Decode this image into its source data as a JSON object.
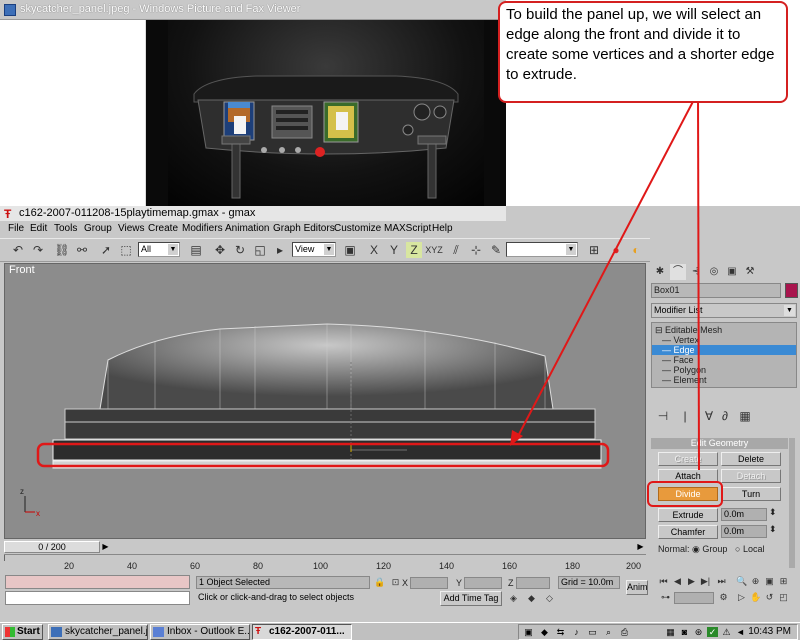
{
  "viewer": {
    "title": "skycatcher_panel.jpeg - Windows Picture and Fax Viewer"
  },
  "callout": {
    "text": "To build the panel up, we will select an edge along the front and divide it to create some vertices and a shorter edge to extrude."
  },
  "gmax": {
    "title": "c162-2007-011208-15playtimemap.gmax - gmax",
    "menu": [
      "File",
      "Edit",
      "Tools",
      "Group",
      "Views",
      "Create",
      "Modifiers",
      "Animation",
      "Graph Editors",
      "Customize",
      "MAXScript",
      "Help"
    ],
    "toolbar": {
      "selection_filter": "All",
      "ref_coord": "View",
      "axis_xyz_label": "XYZ"
    },
    "viewport": {
      "label": "Front"
    },
    "command_panel": {
      "object_name": "Box01",
      "object_color": "#a8144d",
      "modifier_list": "Modifier List",
      "stack": [
        "Editable Mesh",
        "Vertex",
        "Edge",
        "Face",
        "Polygon",
        "Element"
      ],
      "stack_selected": "Edge",
      "rollout_title": "Edit Geometry",
      "buttons": {
        "create": "Create",
        "delete": "Delete",
        "attach": "Attach",
        "detach": "Detach",
        "divide": "Divide",
        "turn": "Turn",
        "extrude": "Extrude",
        "chamfer": "Chamfer"
      },
      "extrude_value": "0.0m",
      "chamfer_value": "0.0m",
      "normal_label": "Normal:",
      "normal_group": "Group",
      "normal_local": "Local"
    },
    "time_slider": "0 / 200",
    "track_labels": [
      "20",
      "40",
      "60",
      "80",
      "100",
      "120",
      "140",
      "160",
      "180",
      "200"
    ],
    "status": {
      "selection": "1 Object Selected",
      "prompt": "Click or click-and-drag to select objects",
      "x_label": "X",
      "y_label": "Y",
      "z_label": "Z",
      "grid": "Grid = 10.0m",
      "add_time_tag": "Add Time Tag",
      "anim": "Anim"
    }
  },
  "taskbar": {
    "start": "Start",
    "tasks": [
      "skycatcher_panel.jp...",
      "Inbox - Outlook E...",
      "c162-2007-011..."
    ],
    "clock": "10:43 PM"
  },
  "accent": {
    "annotation_red": "#d42020",
    "selection_blue": "#3a8ad4",
    "active_orange": "#e89a3c"
  }
}
